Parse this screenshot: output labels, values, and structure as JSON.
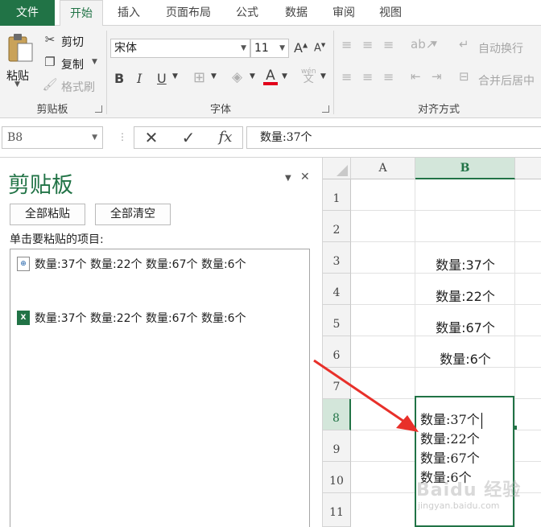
{
  "ribbon_tabs": [
    "文件",
    "开始",
    "插入",
    "页面布局",
    "公式",
    "数据",
    "审阅",
    "视图"
  ],
  "clipboard_group": {
    "paste": "粘贴",
    "cut": "剪切",
    "copy": "复制",
    "format_painter": "格式刷",
    "label": "剪贴板"
  },
  "font_group": {
    "font_name": "宋体",
    "font_size": "11",
    "bold": "B",
    "italic": "I",
    "underline": "U",
    "grow": "A",
    "shrink": "A",
    "color_letter": "A",
    "pinyin": "wén",
    "label": "字体",
    "accent_color": "#e2001a"
  },
  "align_group": {
    "wrap_text": "自动换行",
    "merge_center": "合并后居中",
    "label": "对齐方式"
  },
  "formula_bar": {
    "name_box": "B8",
    "cancel": "✕",
    "enter": "✓",
    "fx": "fx",
    "content": "数量:37个"
  },
  "pane": {
    "title": "剪贴板",
    "paste_all": "全部粘贴",
    "clear_all": "全部清空",
    "hint": "单击要粘贴的项目:",
    "items": [
      {
        "text": "数量:37个 数量:22个 数量:67个 数量:6个",
        "icon": "web-clip-icon"
      },
      {
        "text": "数量:37个 数量:22个 数量:67个 数量:6个",
        "icon": "excel-clip-icon"
      }
    ]
  },
  "sheet": {
    "columns": [
      "A",
      "B"
    ],
    "rows": [
      "1",
      "2",
      "3",
      "4",
      "5",
      "6",
      "7",
      "8",
      "9",
      "10",
      "11"
    ],
    "cells": {
      "B3": "数量:37个",
      "B4": "数量:22个",
      "B5": "数量:67个",
      "B6": "数量:6个"
    },
    "editing": [
      "数量:37个",
      "数量:22个",
      "数量:67个",
      "数量:6个"
    ],
    "watermark": "Baidu 经验",
    "watermark_sub": "jingyan.baidu.com"
  },
  "colors": {
    "brand_green": "#217346",
    "annotation_red": "#e8302a"
  }
}
